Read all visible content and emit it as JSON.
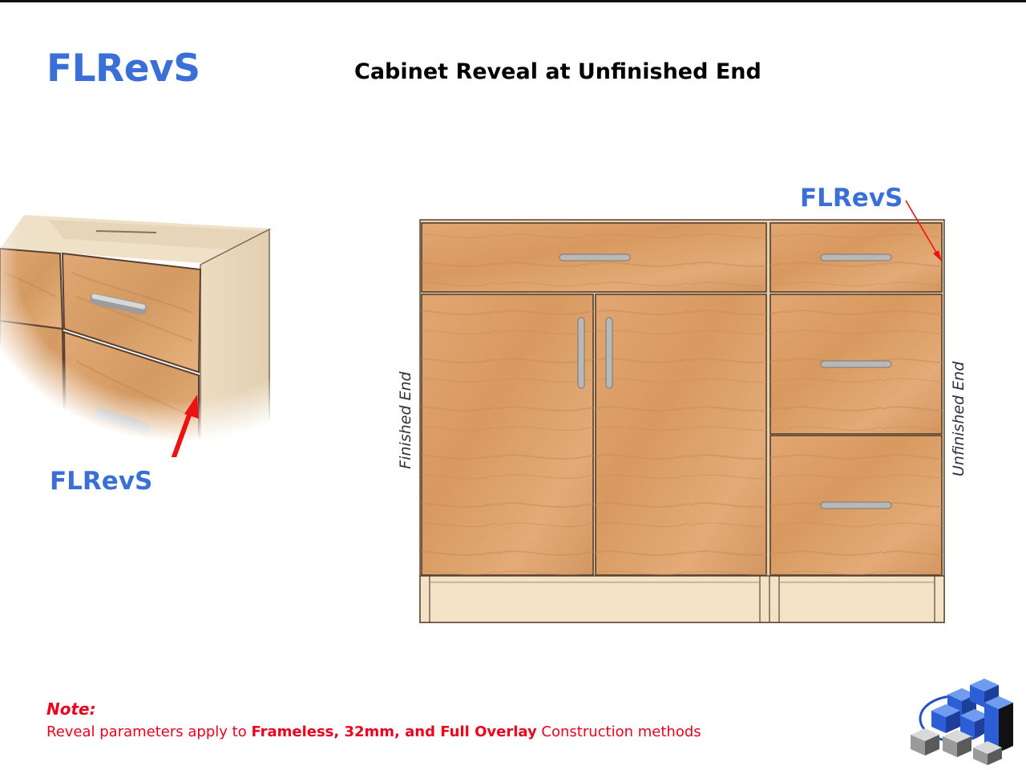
{
  "header": {
    "code": "FLRevS",
    "title": "Cabinet Reveal at Unfinished End"
  },
  "detail_view": {
    "label": "FLRevS"
  },
  "elevation": {
    "label": "FLRevS",
    "left_label": "Finished End",
    "right_label": "Unfinished End"
  },
  "note": {
    "heading": "Note:",
    "text_before": "Reveal parameters apply to ",
    "text_bold": "Frameless, 32mm, and Full Overlay",
    "text_after": " Construction methods"
  },
  "colors": {
    "accent_blue": "#3a6fd8",
    "note_red": "#e8001c",
    "arrow_red": "#ee1111",
    "wood": "#d9a06a",
    "toe_kick": "#f3e2c6"
  },
  "icons": {
    "logo": "cube-cluster-logo-icon",
    "arrow": "red-arrow-icon",
    "handle": "bar-pull-handle-icon"
  }
}
